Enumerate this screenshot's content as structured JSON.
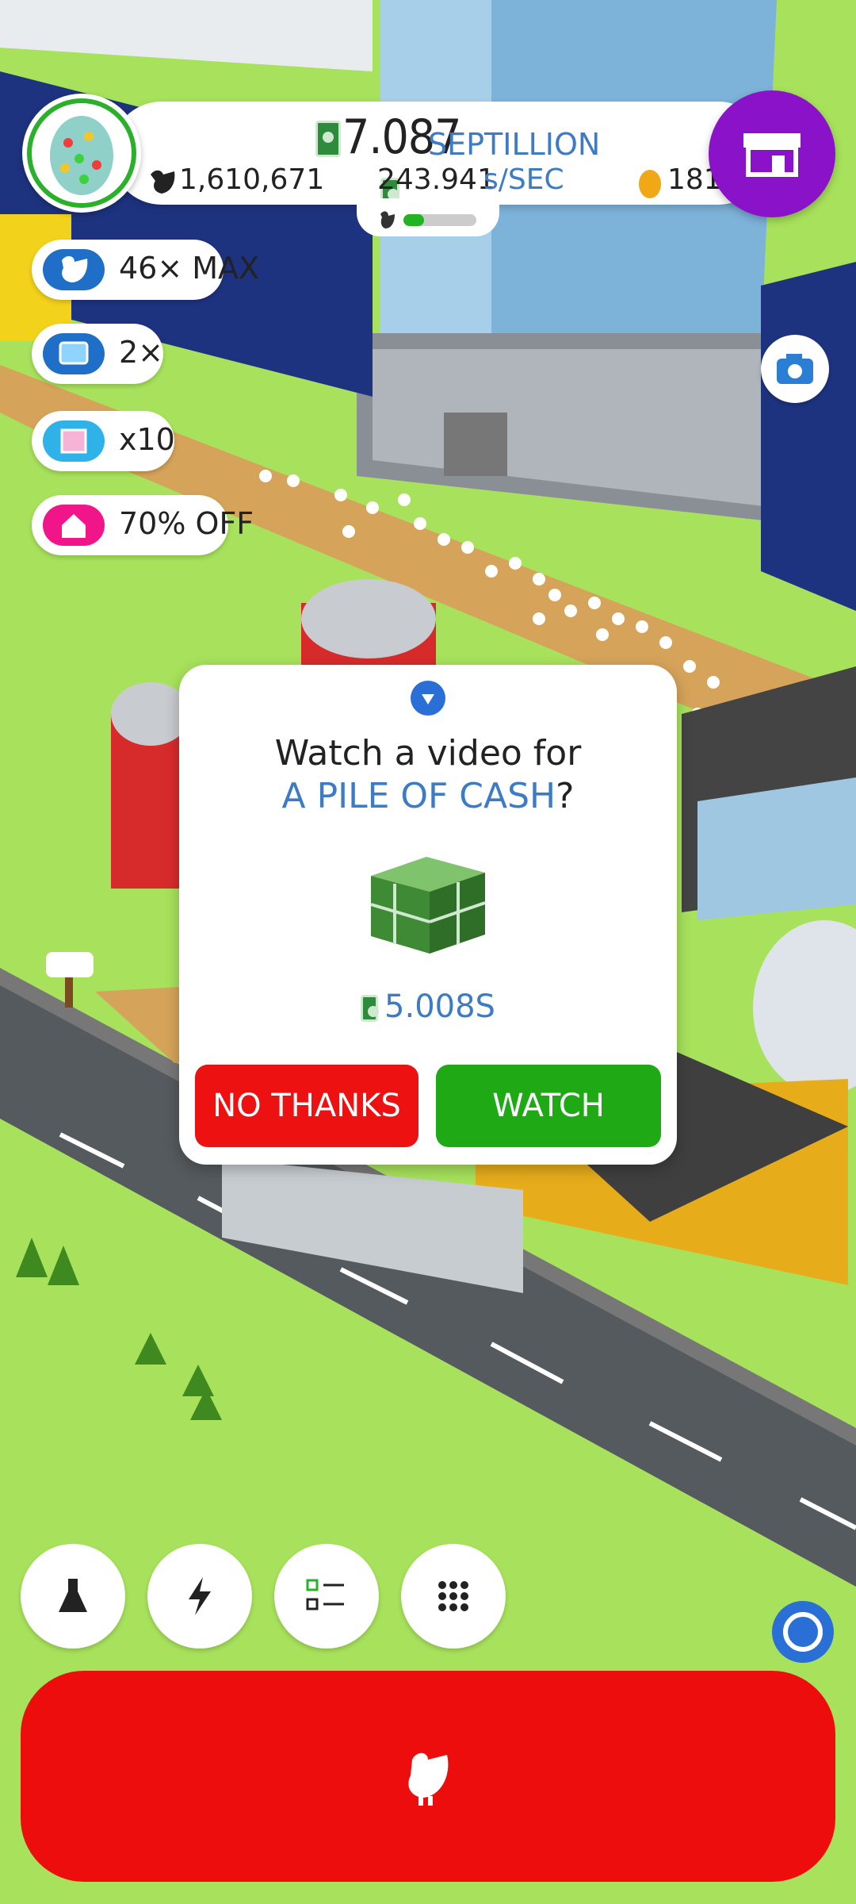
{
  "header": {
    "money_value": "7.087",
    "money_unit": "SEPTILLION",
    "chicken_count": "1,610,671",
    "rate_value": "243.941",
    "rate_unit": "s/SEC",
    "golden_eggs": "181",
    "farm_progress": 0.28
  },
  "boosts": [
    {
      "label": "46× MAX",
      "icon": "chicken-icon",
      "color": "#1f6fc8"
    },
    {
      "label": "2×",
      "icon": "tv-icon",
      "color": "#1f6fc8"
    },
    {
      "label": "x10",
      "icon": "cake-box-icon",
      "color": "#2fb2e8"
    },
    {
      "label": "70% OFF",
      "icon": "house-icon",
      "color": "#f0168a"
    }
  ],
  "dialog": {
    "line1": "Watch a video for",
    "line2": "A PILE OF CASH",
    "question_mark": "?",
    "reward": "5.008S",
    "no_label": "NO THANKS",
    "yes_label": "WATCH"
  },
  "bottom_buttons": [
    {
      "icon": "flask-icon"
    },
    {
      "icon": "lightning-icon"
    },
    {
      "icon": "checklist-icon"
    },
    {
      "icon": "grid-icon"
    }
  ],
  "colors": {
    "shop": "#8a12c9",
    "hatch": "#ee0d0d",
    "no_thanks": "#ee1111",
    "watch": "#1faa15",
    "grass": "#a8e25c"
  }
}
